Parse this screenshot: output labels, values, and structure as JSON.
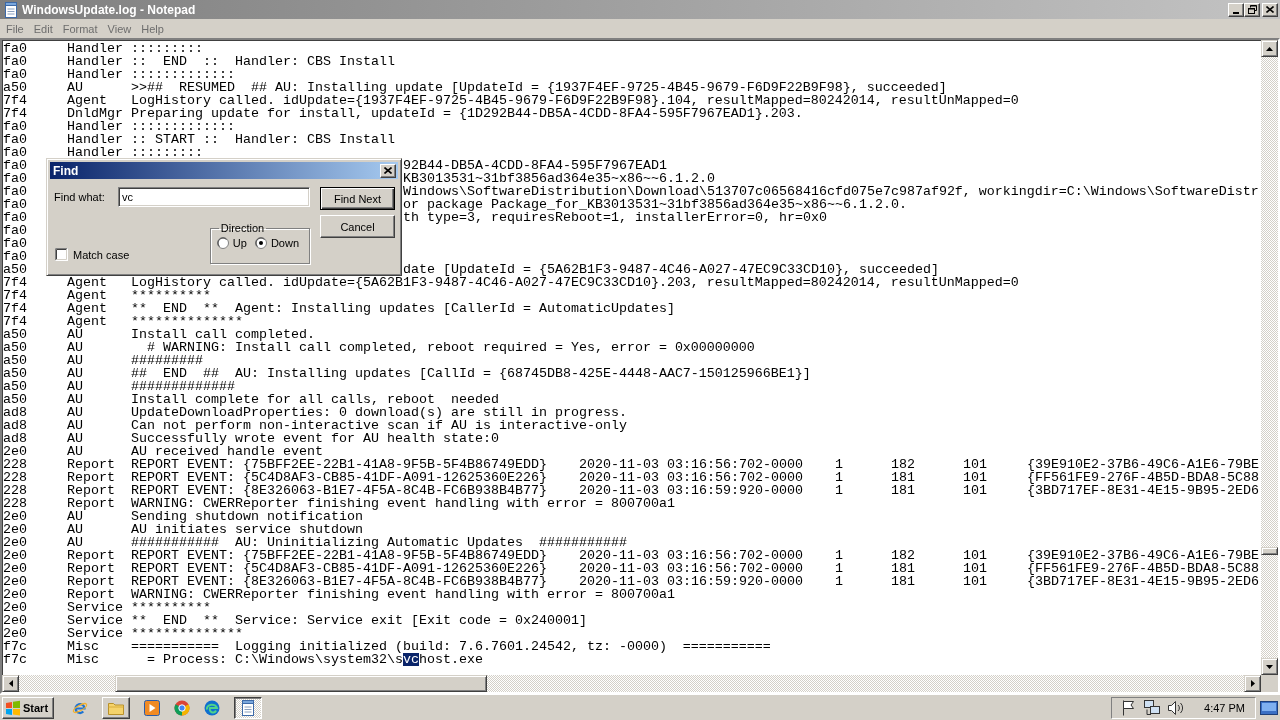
{
  "window": {
    "title": "WindowsUpdate.log - Notepad"
  },
  "menu": [
    "File",
    "Edit",
    "Format",
    "View",
    "Help"
  ],
  "editor": {
    "lines": [
      {
        "kind": "entry",
        "thread": "fa0",
        "component": "Handler",
        "message": ":::::::::"
      },
      {
        "kind": "entry",
        "thread": "fa0",
        "component": "Handler",
        "message": "::  END  ::  Handler: CBS Install"
      },
      {
        "kind": "entry",
        "thread": "fa0",
        "component": "Handler",
        "message": ":::::::::::::"
      },
      {
        "kind": "entry",
        "thread": "a50",
        "component": "AU",
        "message": ">>##  RESUMED  ## AU: Installing update [UpdateId = {1937F4EF-9725-4B45-9679-F6D9F22B9F98}, succeeded]"
      },
      {
        "kind": "entry",
        "thread": "7f4",
        "component": "Agent",
        "message": "LogHistory called. idUpdate={1937F4EF-9725-4B45-9679-F6D9F22B9F98}.104, resultMapped=80242014, resultUnMapped=0"
      },
      {
        "kind": "entry",
        "thread": "7f4",
        "component": "DnldMgr",
        "message": "Preparing update for install, updateId = {1D292B44-DB5A-4CDD-8FA4-595F7967EAD1}.203."
      },
      {
        "kind": "entry",
        "thread": "fa0",
        "component": "Handler",
        "message": ":::::::::::::"
      },
      {
        "kind": "entry",
        "thread": "fa0",
        "component": "Handler",
        "message": ":: START ::  Handler: CBS Install"
      },
      {
        "kind": "entry",
        "thread": "fa0",
        "component": "Handler",
        "message": ":::::::::"
      },
      {
        "kind": "covered",
        "thread": "fa0",
        "message": "92B44-DB5A-4CDD-8FA4-595F7967EAD1"
      },
      {
        "kind": "covered",
        "thread": "fa0",
        "message": "KB3013531~31bf3856ad364e35~x86~~6.1.2.0"
      },
      {
        "kind": "covered",
        "thread": "fa0",
        "message": "Windows\\SoftwareDistribution\\Download\\513707c06568416cfd075e7c987af92f, workingdir=C:\\Windows\\SoftwareDistr"
      },
      {
        "kind": "covered",
        "thread": "fa0",
        "message": "or package Package_for_KB3013531~31bf3856ad364e35~x86~~6.1.2.0."
      },
      {
        "kind": "covered",
        "thread": "fa0",
        "message": "th type=3, requiresReboot=1, installerError=0, hr=0x0"
      },
      {
        "kind": "covered",
        "thread": "fa0"
      },
      {
        "kind": "covered",
        "thread": "fa0"
      },
      {
        "kind": "covered",
        "thread": "fa0"
      },
      {
        "kind": "covered",
        "thread": "a50",
        "message": "date [UpdateId = {5A62B1F3-9487-4C46-A027-47EC9C33CD10}, succeeded]"
      },
      {
        "kind": "entry",
        "thread": "7f4",
        "component": "Agent",
        "message": "LogHistory called. idUpdate={5A62B1F3-9487-4C46-A027-47EC9C33CD10}.203, resultMapped=80242014, resultUnMapped=0"
      },
      {
        "kind": "entry",
        "thread": "7f4",
        "component": "Agent",
        "message": "**********"
      },
      {
        "kind": "entry",
        "thread": "7f4",
        "component": "Agent",
        "message": "**  END  **  Agent: Installing updates [CallerId = AutomaticUpdates]"
      },
      {
        "kind": "entry",
        "thread": "7f4",
        "component": "Agent",
        "message": "**************"
      },
      {
        "kind": "entry",
        "thread": "a50",
        "component": "AU",
        "message": "Install call completed."
      },
      {
        "kind": "entry",
        "thread": "a50",
        "component": "AU",
        "message": "  # WARNING: Install call completed, reboot required = Yes, error = 0x00000000"
      },
      {
        "kind": "entry",
        "thread": "a50",
        "component": "AU",
        "message": "#########"
      },
      {
        "kind": "entry",
        "thread": "a50",
        "component": "AU",
        "message": "##  END  ##  AU: Installing updates [CallId = {68745DB8-425E-4448-AAC7-150125966BE1}]"
      },
      {
        "kind": "entry",
        "thread": "a50",
        "component": "AU",
        "message": "#############"
      },
      {
        "kind": "entry",
        "thread": "a50",
        "component": "AU",
        "message": "Install complete for all calls, reboot  needed"
      },
      {
        "kind": "entry",
        "thread": "ad8",
        "component": "AU",
        "message": "UpdateDownloadProperties: 0 download(s) are still in progress."
      },
      {
        "kind": "entry",
        "thread": "ad8",
        "component": "AU",
        "message": "Can not perform non-interactive scan if AU is interactive-only"
      },
      {
        "kind": "entry",
        "thread": "ad8",
        "component": "AU",
        "message": "Successfully wrote event for AU health state:0"
      },
      {
        "kind": "entry",
        "thread": "2e0",
        "component": "AU",
        "message": "AU received handle event"
      },
      {
        "kind": "entry",
        "thread": "228",
        "component": "Report",
        "message": "REPORT EVENT: {75BFF2EE-22B1-41A8-9F5B-5F4B86749EDD}",
        "fields": [
          "2020-11-03 03:16:56:702-0000",
          "1",
          "182",
          "101",
          "{39E910E2-37B6-49C6-A1E6-79BE"
        ]
      },
      {
        "kind": "entry",
        "thread": "228",
        "component": "Report",
        "message": "REPORT EVENT: {5C4D8AF3-CB85-41DF-A091-12625360E226}",
        "fields": [
          "2020-11-03 03:16:56:702-0000",
          "1",
          "181",
          "101",
          "{FF561FE9-276F-4B5D-BDA8-5C88"
        ]
      },
      {
        "kind": "entry",
        "thread": "228",
        "component": "Report",
        "message": "REPORT EVENT: {8E326063-B1E7-4F5A-8C4B-FC6B938B4B77}",
        "fields": [
          "2020-11-03 03:16:59:920-0000",
          "1",
          "181",
          "101",
          "{3BD717EF-8E31-4E15-9B95-2ED6"
        ]
      },
      {
        "kind": "entry",
        "thread": "228",
        "component": "Report",
        "message": "WARNING: CWERReporter finishing event handling with error = 800700a1"
      },
      {
        "kind": "entry",
        "thread": "2e0",
        "component": "AU",
        "message": "Sending shutdown notification"
      },
      {
        "kind": "entry",
        "thread": "2e0",
        "component": "AU",
        "message": "AU initiates service shutdown"
      },
      {
        "kind": "entry",
        "thread": "2e0",
        "component": "AU",
        "message": "###########  AU: Uninitializing Automatic Updates  ###########"
      },
      {
        "kind": "entry",
        "thread": "2e0",
        "component": "Report",
        "message": "REPORT EVENT: {75BFF2EE-22B1-41A8-9F5B-5F4B86749EDD}",
        "fields": [
          "2020-11-03 03:16:56:702-0000",
          "1",
          "182",
          "101",
          "{39E910E2-37B6-49C6-A1E6-79BE"
        ]
      },
      {
        "kind": "entry",
        "thread": "2e0",
        "component": "Report",
        "message": "REPORT EVENT: {5C4D8AF3-CB85-41DF-A091-12625360E226}",
        "fields": [
          "2020-11-03 03:16:56:702-0000",
          "1",
          "181",
          "101",
          "{FF561FE9-276F-4B5D-BDA8-5C88"
        ]
      },
      {
        "kind": "entry",
        "thread": "2e0",
        "component": "Report",
        "message": "REPORT EVENT: {8E326063-B1E7-4F5A-8C4B-FC6B938B4B77}",
        "fields": [
          "2020-11-03 03:16:59:920-0000",
          "1",
          "181",
          "101",
          "{3BD717EF-8E31-4E15-9B95-2ED6"
        ]
      },
      {
        "kind": "entry",
        "thread": "2e0",
        "component": "Report",
        "message": "WARNING: CWERReporter finishing event handling with error = 800700a1"
      },
      {
        "kind": "entry",
        "thread": "2e0",
        "component": "Service",
        "message": "**********"
      },
      {
        "kind": "entry",
        "thread": "2e0",
        "component": "Service",
        "message": "**  END  **  Service: Service exit [Exit code = 0x240001]"
      },
      {
        "kind": "entry",
        "thread": "2e0",
        "component": "Service",
        "message": "**************"
      },
      {
        "kind": "entry",
        "thread": "f7c",
        "component": "Misc",
        "message": "===========  Logging initialized (build: 7.6.7601.24542, tz: -0000)  ==========="
      },
      {
        "kind": "entry",
        "thread": "f7c",
        "component": "Misc",
        "parts": [
          {
            "text": "  = Process: C:\\Windows\\system32\\s",
            "selected": false
          },
          {
            "text": "vc",
            "selected": true
          },
          {
            "text": "host.exe",
            "selected": false
          }
        ]
      }
    ]
  },
  "find_dialog": {
    "title": "Find",
    "find_what": {
      "label": "Find what:",
      "value": "vc"
    },
    "direction": {
      "label": "Direction",
      "options": [
        {
          "label": "Up",
          "selected": false
        },
        {
          "label": "Down",
          "selected": true
        }
      ]
    },
    "match_case": {
      "label": "Match case",
      "checked": false
    },
    "buttons": [
      {
        "label": "Find Next",
        "default": true
      },
      {
        "label": "Cancel",
        "default": false
      }
    ]
  },
  "taskbar": {
    "start": "Start",
    "apps": [
      {
        "kind": "launcher",
        "selected": false
      },
      {
        "kind": "task",
        "selected": false
      },
      {
        "kind": "launcher",
        "selected": false
      },
      {
        "kind": "launcher",
        "selected": false
      },
      {
        "kind": "launcher",
        "selected": false
      },
      {
        "kind": "task",
        "selected": true
      }
    ],
    "clock": "4:47 PM"
  }
}
